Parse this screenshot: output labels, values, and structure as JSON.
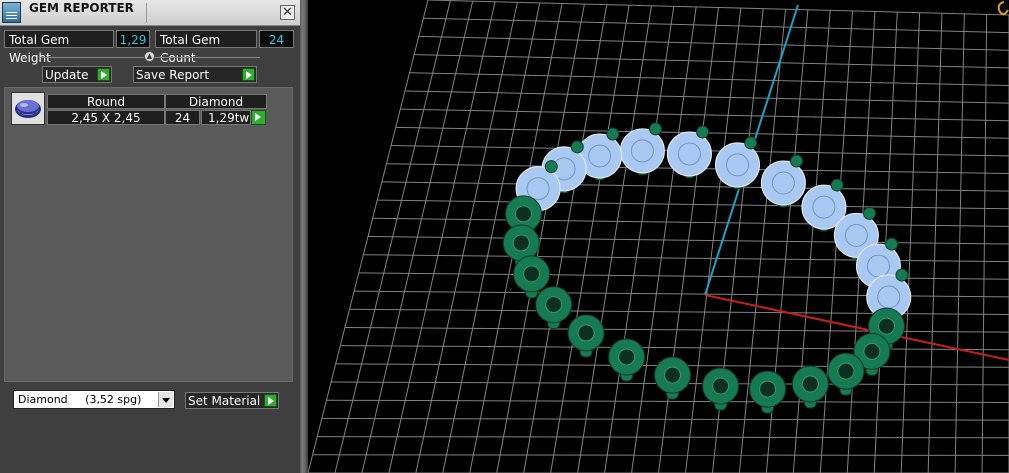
{
  "window": {
    "title": "GEM REPORTER"
  },
  "summary": {
    "weight_label": "Total Gem Weight",
    "weight_value": "1,29",
    "count_label": "Total Gem Count",
    "count_value": "24"
  },
  "actions": {
    "update_label": "Update",
    "save_report_label": "Save Report"
  },
  "gem_table": {
    "rows": [
      {
        "shape": "Round",
        "material": "Diamond",
        "size": "2,45 X 2,45",
        "count": "24",
        "weight": "1,29tw"
      }
    ]
  },
  "material_select": {
    "value": "Diamond     (3,52 spg)"
  },
  "set_material_label": "Set Material",
  "colors": {
    "panel_bg": "#3f3f3f",
    "value_text": "#2ec9e8",
    "play_green": "#2fae2f",
    "gem_blue": "#a9c9f2",
    "setting_green": "#167a52",
    "axis_red": "#c81e1e",
    "axis_cyan": "#1aa3c8",
    "grid": "#9a9a9a"
  },
  "icons": [
    "app-icon",
    "close-icon",
    "collapse-icon",
    "play-icon",
    "dropdown-arrow-icon",
    "gem-round-icon",
    "view-cube-icon"
  ]
}
